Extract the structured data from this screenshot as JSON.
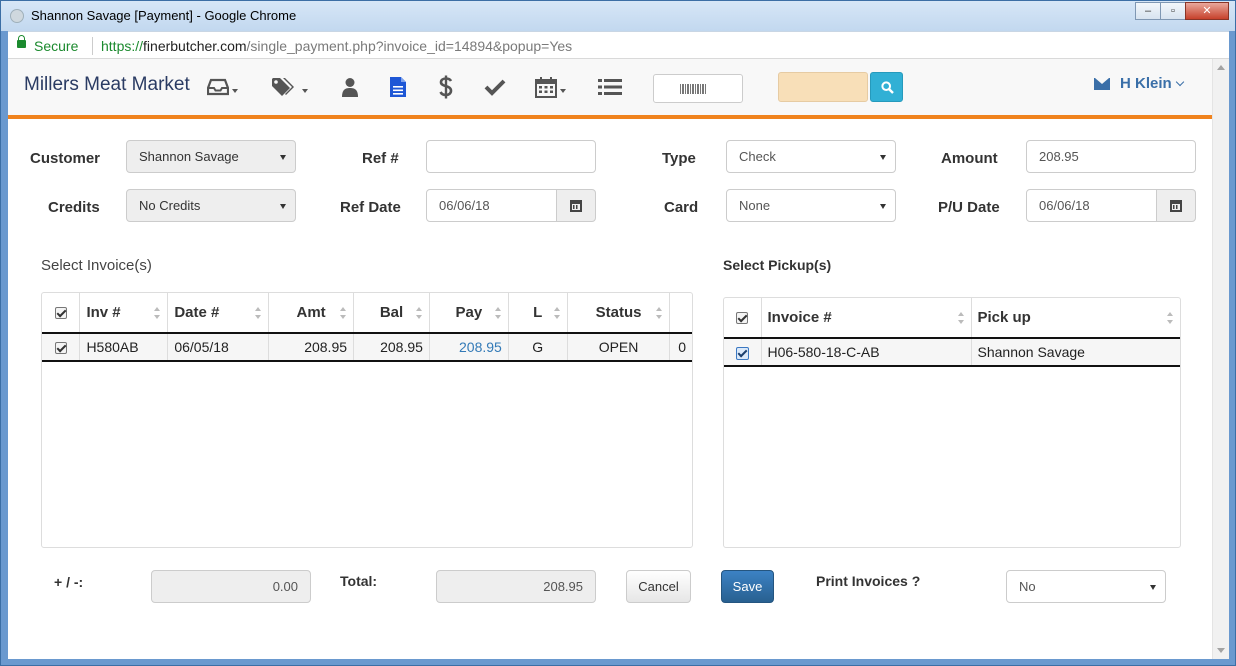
{
  "window": {
    "title": "Shannon Savage [Payment] - Google Chrome",
    "controls": {
      "minimize": "–",
      "maximize": "▫",
      "close": "✕"
    }
  },
  "address_bar": {
    "secure_label": "Secure",
    "url_scheme": "https://",
    "url_host": "finerbutcher.com",
    "url_path": "/single_payment.php?invoice_id=14894&popup=Yes"
  },
  "navbar": {
    "brand": "Millers Meat Market",
    "icons": [
      "inbox-icon",
      "tags-icon",
      "user-icon",
      "file-icon",
      "dollar-icon",
      "check-icon",
      "calendar-icon",
      "list-icon"
    ],
    "search_button_icon": "search-icon",
    "user_name": "H Klein",
    "accent_color": "#f0831e"
  },
  "form": {
    "customer_label": "Customer",
    "customer_value": "Shannon Savage",
    "ref_label": "Ref #",
    "ref_value": "",
    "type_label": "Type",
    "type_value": "Check",
    "amount_label": "Amount",
    "amount_value": "208.95",
    "credits_label": "Credits",
    "credits_value": "No Credits",
    "ref_date_label": "Ref Date",
    "ref_date_value": "06/06/18",
    "card_label": "Card",
    "card_value": "None",
    "pu_date_label": "P/U Date",
    "pu_date_value": "06/06/18"
  },
  "invoices": {
    "title": "Select Invoice(s)",
    "columns": [
      "Inv #",
      "Date #",
      "Amt",
      "Bal",
      "Pay",
      "L",
      "Status"
    ],
    "rows": [
      {
        "checked": true,
        "inv": "H580AB",
        "date": "06/05/18",
        "amt": "208.95",
        "bal": "208.95",
        "pay": "208.95",
        "l": "G",
        "status": "OPEN",
        "extra": "0"
      }
    ]
  },
  "pickups": {
    "title": "Select Pickup(s)",
    "columns": [
      "Invoice #",
      "Pick up"
    ],
    "rows": [
      {
        "checked": true,
        "invoice": "H06-580-18-C-AB",
        "pickup": "Shannon Savage"
      }
    ]
  },
  "footer": {
    "adjust_label": "+ / -:",
    "adjust_value": "0.00",
    "total_label": "Total:",
    "total_value": "208.95",
    "cancel_label": "Cancel",
    "save_label": "Save",
    "print_label": "Print Invoices ?",
    "print_value": "No"
  }
}
